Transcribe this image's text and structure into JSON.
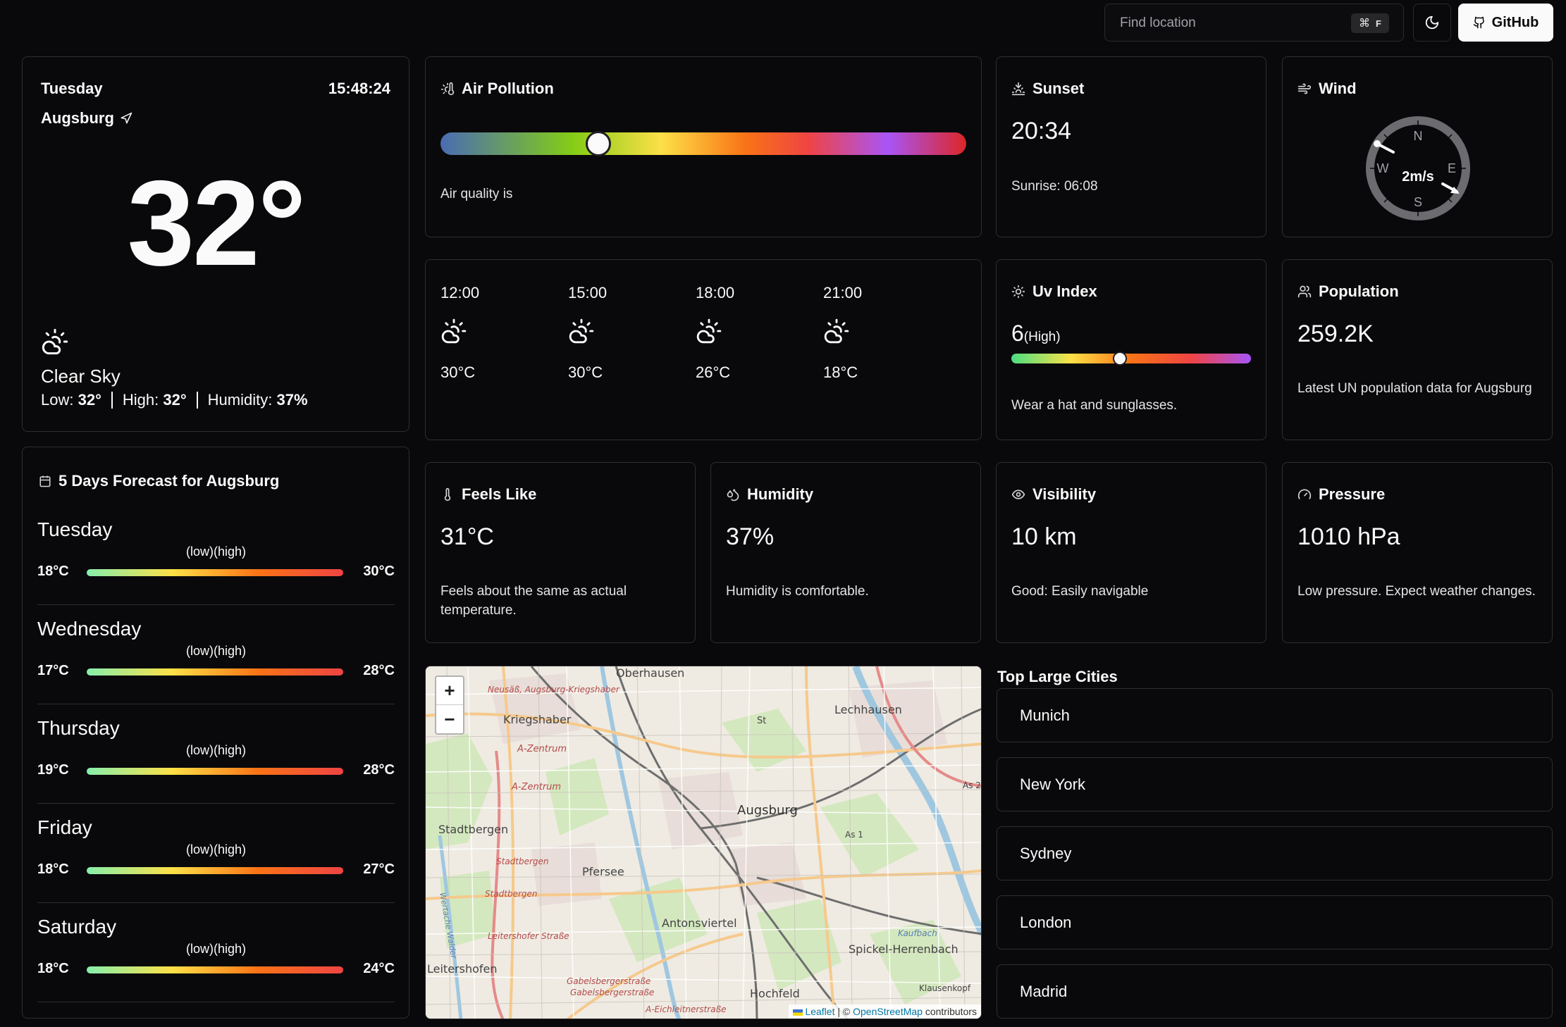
{
  "header": {
    "search_placeholder": "Find location",
    "shortcut_symbol": "⌘",
    "shortcut_key": "F",
    "github_label": "GitHub"
  },
  "current": {
    "day": "Tuesday",
    "time": "15:48:24",
    "city": "Augsburg",
    "temperature": "32°",
    "description": "Clear Sky",
    "low_label": "Low:",
    "low": "32°",
    "high_label": "High:",
    "high": "32°",
    "humidity_label": "Humidity:",
    "humidity": "37%"
  },
  "air_pollution": {
    "title": "Air Pollution",
    "text": "Air quality is",
    "level_fraction": 0.3
  },
  "sunset": {
    "title": "Sunset",
    "value": "20:34",
    "sunrise": "Sunrise: 06:08"
  },
  "wind": {
    "title": "Wind",
    "speed": "2m/s",
    "n": "N",
    "e": "E",
    "s": "S",
    "w": "W"
  },
  "hourly": [
    {
      "time": "12:00",
      "temp": "30°C"
    },
    {
      "time": "15:00",
      "temp": "30°C"
    },
    {
      "time": "18:00",
      "temp": "26°C"
    },
    {
      "time": "21:00",
      "temp": "18°C"
    }
  ],
  "uv": {
    "title": "Uv Index",
    "value": "6",
    "level": "(High)",
    "advice": "Wear a hat and sunglasses.",
    "level_fraction": 0.45
  },
  "population": {
    "title": "Population",
    "value": "259.2K",
    "desc": "Latest UN population data for Augsburg"
  },
  "feels_like": {
    "title": "Feels Like",
    "value": "31°C",
    "desc": "Feels about the same as actual temperature."
  },
  "humidity_card": {
    "title": "Humidity",
    "value": "37%",
    "desc": "Humidity is comfortable."
  },
  "visibility": {
    "title": "Visibility",
    "value": "10 km",
    "desc": "Good: Easily navigable"
  },
  "pressure": {
    "title": "Pressure",
    "value": "1010 hPa",
    "desc": "Low pressure. Expect weather changes."
  },
  "forecast": {
    "title": "5 Days Forecast for Augsburg",
    "low_high_label": "(low)(high)",
    "days": [
      {
        "day": "Tuesday",
        "low": "18°C",
        "high": "30°C"
      },
      {
        "day": "Wednesday",
        "low": "17°C",
        "high": "28°C"
      },
      {
        "day": "Thursday",
        "low": "19°C",
        "high": "28°C"
      },
      {
        "day": "Friday",
        "low": "18°C",
        "high": "27°C"
      },
      {
        "day": "Saturday",
        "low": "18°C",
        "high": "24°C"
      }
    ]
  },
  "map": {
    "zoom_in": "+",
    "zoom_out": "−",
    "attribution_leaflet": "Leaflet",
    "attribution_sep": "| ©",
    "attribution_osm": "OpenStreetMap",
    "attribution_tail": "contributors",
    "labels": {
      "augsburg": "Augsburg",
      "oberhausen": "Oberhausen",
      "kriegshaber": "Kriegshaber",
      "lechhausen": "Lechhausen",
      "stadtbergen": "Stadtbergen",
      "pfersee": "Pfersee",
      "antonsviertel": "Antonsviertel",
      "spickel": "Spickel-Herrenbach",
      "hochfeld": "Hochfeld",
      "leitershofen": "Leitershofen",
      "neusass": "Neusäß, Augsburg-Kriegshaber",
      "a_zentrum_1": "A-Zentrum",
      "a_zentrum_2": "A-Zentrum",
      "stadtbergen_road": "Stadtbergen",
      "stadtbergen_road2": "Stadtbergen",
      "leitershofer": "Leitershofer Straße",
      "gabelsberger1": "Gabelsbergerstraße",
      "gabelsberger2": "Gabelsbergerstraße",
      "eichleitner": "A-Eichleitnerstraße",
      "as1": "As 1",
      "as2": "As 2",
      "st": "St",
      "kaufbach": "Kaufbach",
      "klausenkopf": "Klausenkopf",
      "wertache": "Wertache Walder"
    }
  },
  "cities": {
    "title": "Top Large Cities",
    "items": [
      "Munich",
      "New York",
      "Sydney",
      "London",
      "Madrid"
    ]
  }
}
